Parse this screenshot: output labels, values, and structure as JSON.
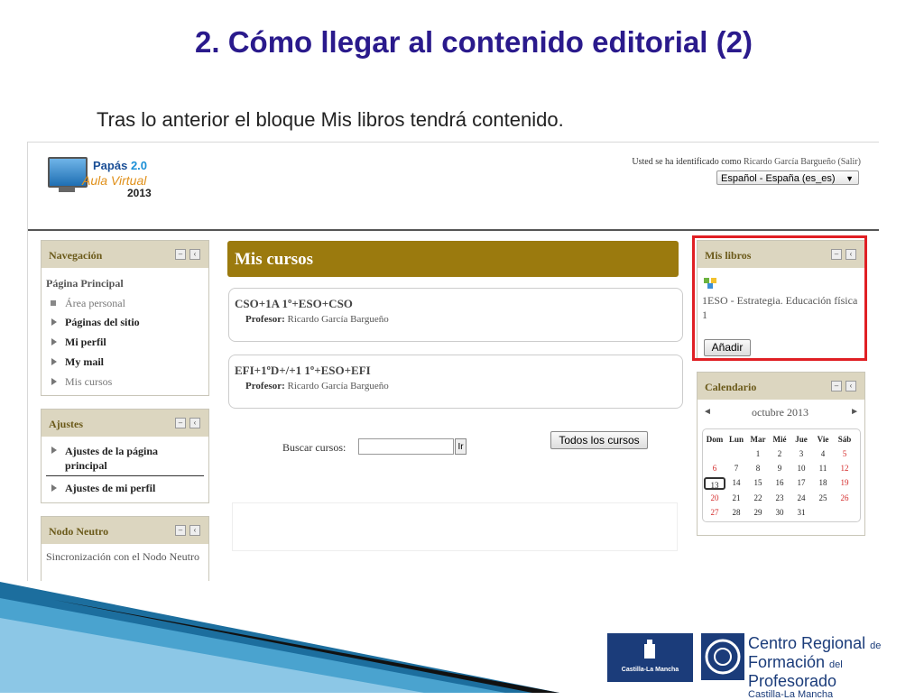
{
  "slide": {
    "title": "2. Cómo llegar al contenido editorial (2)",
    "subtitle": "Tras lo anterior el bloque Mis libros tendrá contenido."
  },
  "header": {
    "logo": {
      "papas": "Papás",
      "version": "2.0",
      "aula": "Aula Virtual",
      "year": "2013"
    },
    "login_prefix": "Usted se ha identificado como",
    "user": "Ricardo García Bargueño",
    "logout": "(Salir)",
    "language": "Español - España (es_es)"
  },
  "navigation": {
    "title": "Navegación",
    "root": "Página Principal",
    "items": [
      {
        "label": "Área personal"
      },
      {
        "label": "Páginas del sitio"
      },
      {
        "label": "Mi perfil"
      },
      {
        "label": "My mail"
      },
      {
        "label": "Mis cursos"
      }
    ]
  },
  "ajustes": {
    "title": "Ajustes",
    "items": [
      {
        "label": "Ajustes de la página principal"
      },
      {
        "label": "Ajustes de mi perfil"
      }
    ]
  },
  "nodo": {
    "title": "Nodo Neutro",
    "text": "Sincronización con el Nodo Neutro"
  },
  "mis_cursos": {
    "title": "Mis cursos",
    "courses": [
      {
        "name": "CSO+1A 1º+ESO+CSO",
        "prof_label": "Profesor:",
        "prof": "Ricardo García Bargueño"
      },
      {
        "name": "EFI+1ºD+/+1 1º+ESO+EFI",
        "prof_label": "Profesor:",
        "prof": "Ricardo García Bargueño"
      }
    ],
    "search_label": "Buscar cursos:",
    "search_go": "Ir",
    "all_courses": "Todos los cursos"
  },
  "mis_libros": {
    "title": "Mis libros",
    "book": "1ESO - Estrategia. Educación física 1",
    "add": "Añadir"
  },
  "calendar": {
    "title": "Calendario",
    "month": "octubre 2013",
    "prev": "◄",
    "next": "►",
    "weekdays": [
      "Dom",
      "Lun",
      "Mar",
      "Mié",
      "Jue",
      "Vie",
      "Sáb"
    ],
    "weeks": [
      [
        "",
        "",
        "1",
        "2",
        "3",
        "4",
        "5"
      ],
      [
        "6",
        "7",
        "8",
        "9",
        "10",
        "11",
        "12"
      ],
      [
        "13",
        "14",
        "15",
        "16",
        "17",
        "18",
        "19"
      ],
      [
        "20",
        "21",
        "22",
        "23",
        "24",
        "25",
        "26"
      ],
      [
        "27",
        "28",
        "29",
        "30",
        "31",
        "",
        ""
      ]
    ],
    "today": "13"
  },
  "footer": {
    "jccm": "Castilla-La Mancha",
    "crfp_line1": "Centro Regional",
    "crfp_de": "de",
    "crfp_line2": "Formación",
    "crfp_del": "del",
    "crfp_prof": "Profesorado",
    "crfp_line3": "Castilla-La Mancha"
  },
  "colors": {
    "title": "#2a1a8c",
    "bar": "#9b7a0e",
    "highlight": "#e01f24",
    "block_header": "#dcd6c0"
  }
}
